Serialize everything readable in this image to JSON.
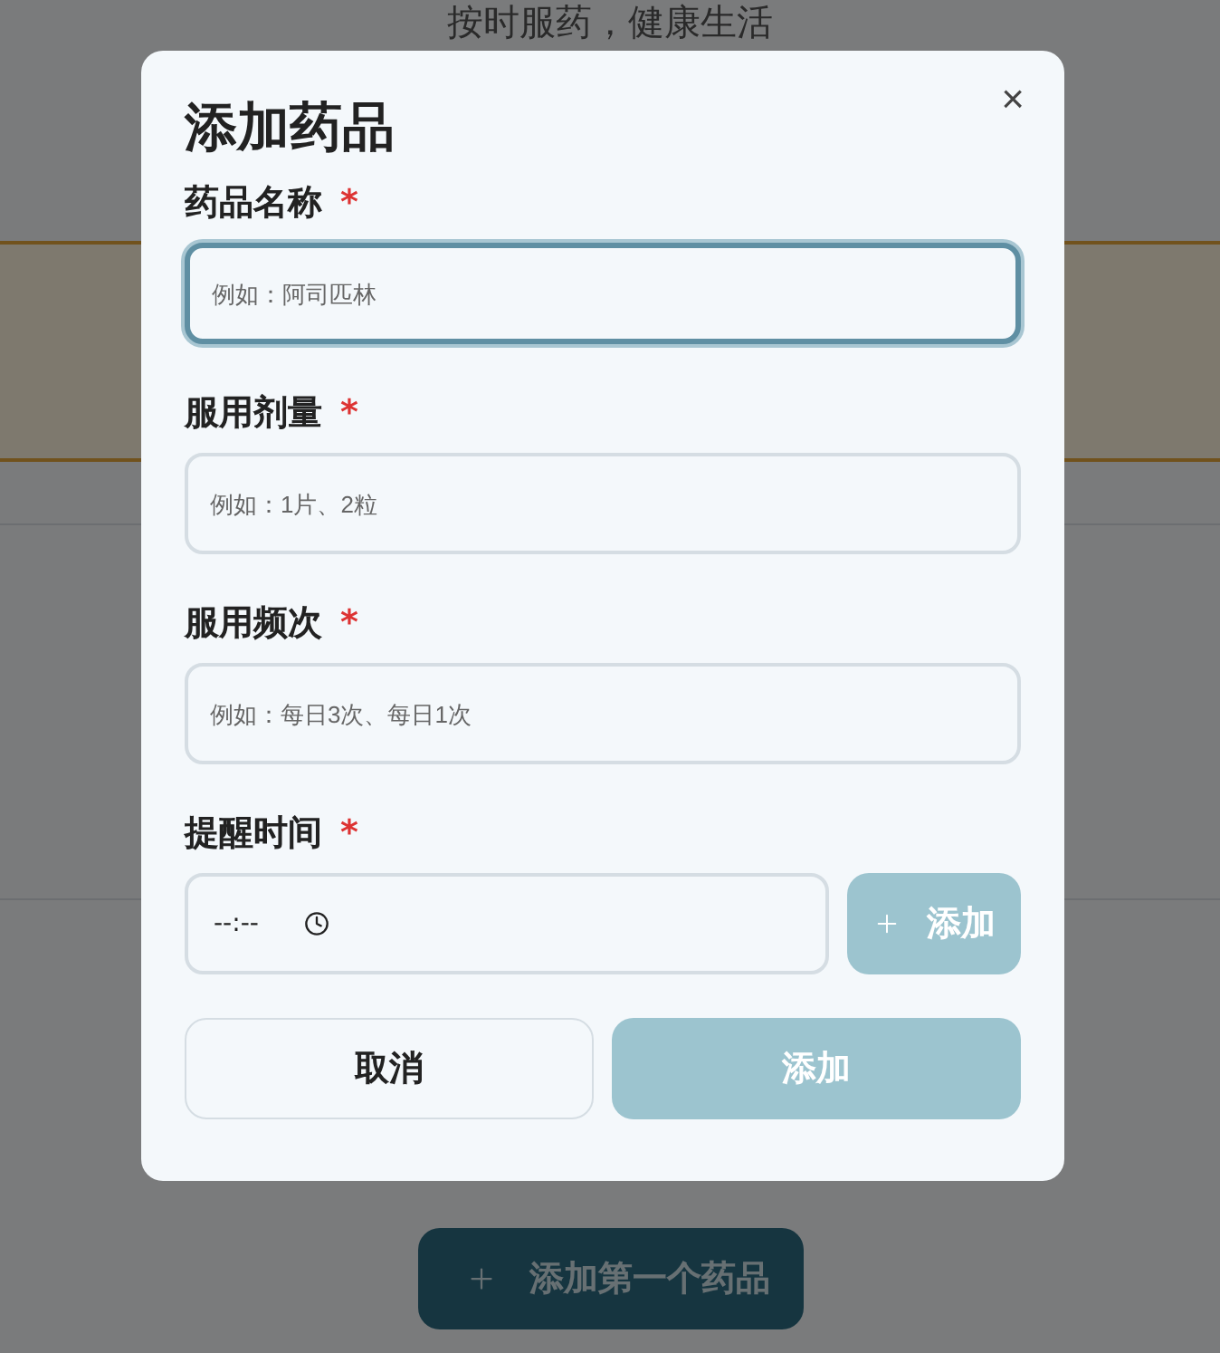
{
  "page": {
    "subtitle": "按时服药，健康生活",
    "empty_button": {
      "label": "添加第一个药品"
    }
  },
  "dialog": {
    "title": "添加药品",
    "close": "×",
    "fields": [
      {
        "kind": "text",
        "label": "药品名称",
        "required_mark": "*",
        "placeholder": "例如：阿司匹林",
        "focused": true
      },
      {
        "kind": "text",
        "label": "服用剂量",
        "required_mark": "*",
        "placeholder": "例如：1片、2粒",
        "focused": false
      },
      {
        "kind": "text",
        "label": "服用频次",
        "required_mark": "*",
        "placeholder": "例如：每日3次、每日1次",
        "focused": false
      },
      {
        "kind": "time",
        "label": "提醒时间",
        "required_mark": "*",
        "value": "--:--",
        "focused": false,
        "add_button": {
          "label": "添加",
          "disabled": true
        }
      }
    ],
    "buttons": [
      {
        "kind": "secondary",
        "label": "取消"
      },
      {
        "kind": "primary",
        "label": "添加",
        "disabled": true
      }
    ]
  }
}
